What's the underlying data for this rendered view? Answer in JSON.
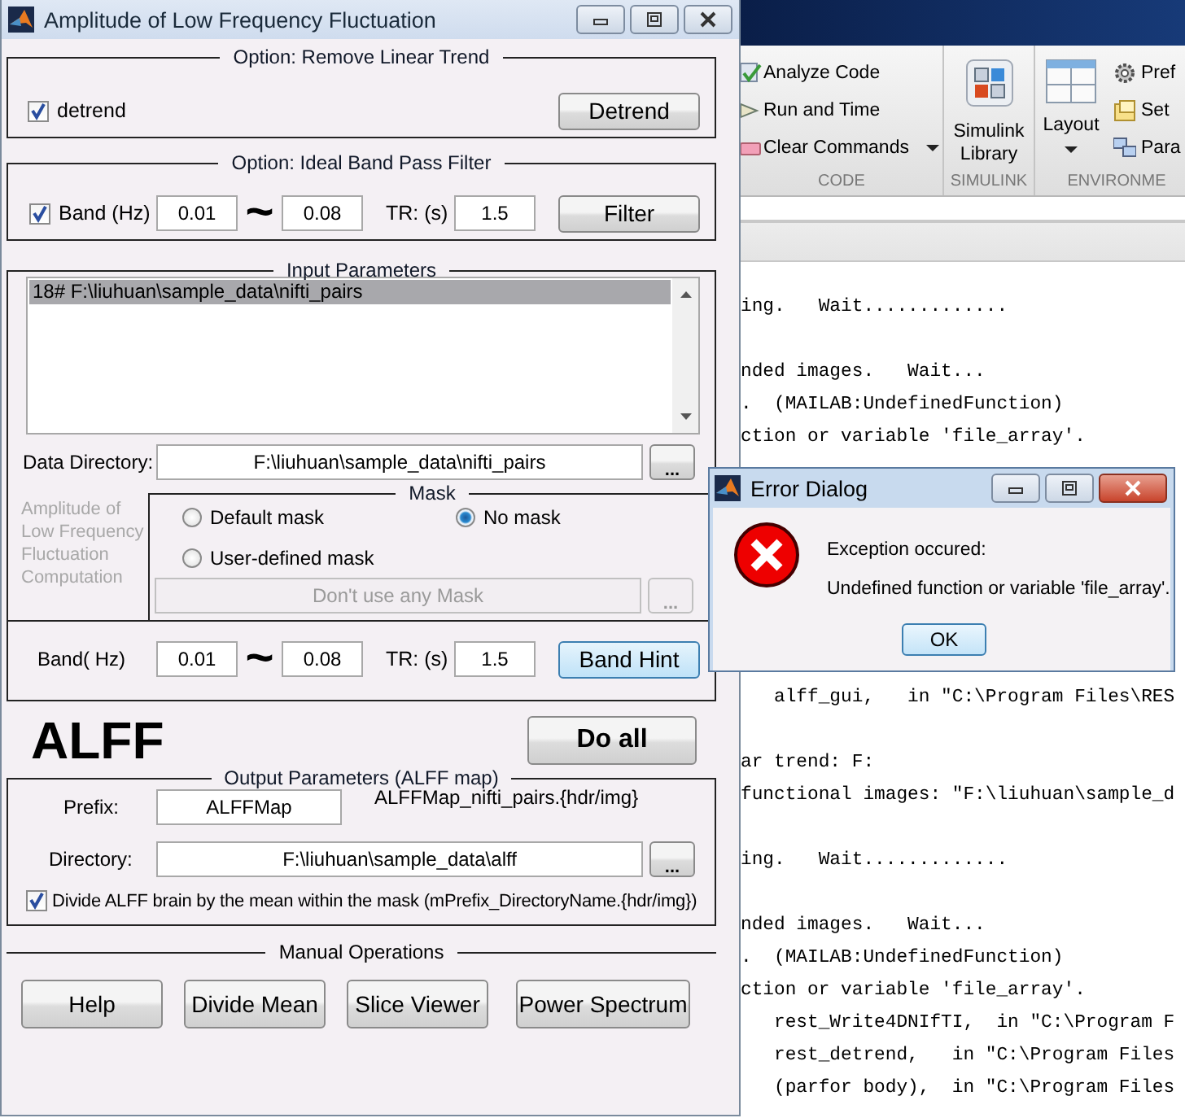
{
  "matlab": {
    "toolstrip": {
      "code": {
        "label": "CODE",
        "items": [
          "Analyze Code",
          "Run and Time",
          "Clear Commands"
        ]
      },
      "simulink": {
        "label": "SIMULINK",
        "library": "Simulink Library"
      },
      "environment": {
        "label": "ENVIRONME",
        "layout": "Layout",
        "items": [
          "Pref",
          "Set",
          "Para"
        ]
      }
    },
    "console": {
      "upper_blocks": [
        [
          "ing.   Wait............."
        ],
        [
          "nded images.   Wait...",
          ".  (MAILAB:UndefinedFunction)",
          "ction or variable 'file_array'."
        ]
      ],
      "lower_blocks": [
        [
          "   alff_gui,   in \"C:\\Program Files\\RES"
        ],
        [
          "ar trend: F:",
          "functional images: \"F:\\liuhuan\\sample_d"
        ],
        [
          "ing.   Wait............."
        ],
        [
          "nded images.   Wait...",
          ".  (MAILAB:UndefinedFunction)",
          "ction or variable 'file_array'.",
          "   rest_Write4DNIfTI,  in \"C:\\Program F",
          "   rest_detrend,   in \"C:\\Program Files",
          "   (parfor body),  in \"C:\\Program Files"
        ]
      ]
    }
  },
  "alff_window": {
    "title": "Amplitude of Low Frequency Fluctuation",
    "detrend_panel": {
      "title": "Option: Remove Linear Trend",
      "checkbox": {
        "label": "detrend",
        "checked": true
      },
      "button": "Detrend"
    },
    "filter_panel": {
      "title": "Option: Ideal Band Pass Filter",
      "checkbox": {
        "label": "Band (Hz)",
        "checked": true
      },
      "low": "0.01",
      "separator": "~",
      "high": "0.08",
      "tr_label": "TR: (s)",
      "tr": "1.5",
      "button": "Filter"
    },
    "input_panel": {
      "title": "Input Parameters",
      "list": [
        {
          "text": "18# F:\\liuhuan\\sample_data\\nifti_pairs",
          "selected": true
        }
      ],
      "data_dir_label": "Data Directory:",
      "data_dir": "F:\\liuhuan\\sample_data\\nifti_pairs",
      "browse": "...",
      "side_note": "Amplitude of Low Frequency Fluctuation Computation",
      "mask": {
        "title": "Mask",
        "options": [
          {
            "label": "Default mask",
            "selected": false
          },
          {
            "label": "No mask",
            "selected": true
          },
          {
            "label": "User-defined mask",
            "selected": false
          }
        ],
        "file": "Don't use any Mask",
        "browse": "...",
        "disabled": true
      }
    },
    "band_panel": {
      "label": "Band( Hz)",
      "low": "0.01",
      "separator": "~",
      "high": "0.08",
      "tr_label": "TR: (s)",
      "tr": "1.5",
      "button": {
        "label": "Band Hint",
        "highlighted": true
      }
    },
    "heading": "ALFF",
    "do_all": "Do all",
    "output_panel": {
      "title": "Output Parameters (ALFF map)",
      "prefix_label": "Prefix:",
      "prefix": "ALFFMap",
      "prefix_preview": "ALFFMap_nifti_pairs.{hdr/img}",
      "directory_label": "Directory:",
      "directory": "F:\\liuhuan\\sample_data\\alff",
      "browse": "...",
      "checkbox": {
        "label": "Divide ALFF brain by the mean within the mask (mPrefix_DirectoryName.{hdr/img})",
        "checked": true
      }
    },
    "manual": {
      "title": "Manual Operations",
      "buttons": [
        "Help",
        "Divide Mean",
        "Slice Viewer",
        "Power Spectrum"
      ]
    }
  },
  "error_dialog": {
    "title": "Error Dialog",
    "lines": [
      "Exception occured:",
      "Undefined function or variable 'file_array'."
    ],
    "button": "OK"
  }
}
